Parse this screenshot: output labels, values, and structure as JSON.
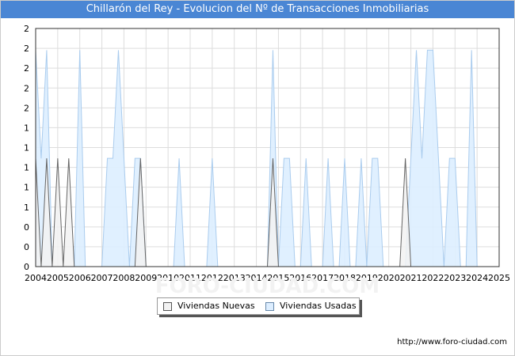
{
  "title": "Chillarón del Rey - Evolucion del Nº de Transacciones Inmobiliarias",
  "url": "http://www.foro-ciudad.com",
  "watermark": "FORO-CIUDAD.COM",
  "colors": {
    "title_bg": "#4a86d4",
    "nuevas_fill": "#f2f2f2",
    "nuevas_line": "#666666",
    "usadas_fill": "#ddeeff",
    "usadas_line": "#aaccee"
  },
  "chart_data": {
    "type": "area",
    "title": "Chillarón del Rey - Evolucion del Nº de Transacciones Inmobiliarias",
    "xlabel": "",
    "ylabel": "",
    "x_tick_labels": [
      "2004",
      "2005",
      "2006",
      "2007",
      "2008",
      "2009",
      "2010",
      "2011",
      "2012",
      "2013",
      "2014",
      "2015",
      "2016",
      "2017",
      "2018",
      "2019",
      "2020",
      "2021",
      "2022",
      "2023",
      "2024",
      "2025"
    ],
    "y_tick_labels": [
      "0",
      "0",
      "0",
      "1",
      "1",
      "1",
      "1",
      "1",
      "2",
      "2",
      "2",
      "2"
    ],
    "xlim": [
      2004,
      2025
    ],
    "ylim": [
      0,
      2.2
    ],
    "grid": true,
    "legend_position": "bottom-center",
    "series": [
      {
        "name": "Viviendas Nuevas",
        "points": [
          [
            2004,
            1
          ],
          [
            2004.25,
            0
          ],
          [
            2004.5,
            1
          ],
          [
            2004.75,
            0
          ],
          [
            2005,
            1
          ],
          [
            2005.25,
            0
          ],
          [
            2005.5,
            1
          ],
          [
            2005.75,
            0
          ],
          [
            2008.5,
            0
          ],
          [
            2008.75,
            1
          ],
          [
            2009,
            0
          ],
          [
            2014.5,
            0
          ],
          [
            2014.75,
            1
          ],
          [
            2015,
            0
          ],
          [
            2020.5,
            0
          ],
          [
            2020.75,
            1
          ],
          [
            2021,
            0
          ]
        ]
      },
      {
        "name": "Viviendas Usadas",
        "points": [
          [
            2004,
            2
          ],
          [
            2004.25,
            1
          ],
          [
            2004.5,
            2
          ],
          [
            2004.75,
            0
          ],
          [
            2005.75,
            0
          ],
          [
            2006,
            2
          ],
          [
            2006.25,
            0
          ],
          [
            2007,
            0
          ],
          [
            2007.25,
            1
          ],
          [
            2007.5,
            1
          ],
          [
            2007.75,
            2
          ],
          [
            2008,
            1
          ],
          [
            2008.25,
            0
          ],
          [
            2008.5,
            1
          ],
          [
            2008.75,
            1
          ],
          [
            2009,
            0
          ],
          [
            2010.25,
            0
          ],
          [
            2010.5,
            1
          ],
          [
            2010.75,
            0
          ],
          [
            2011.75,
            0
          ],
          [
            2012,
            1
          ],
          [
            2012.25,
            0
          ],
          [
            2014.5,
            0
          ],
          [
            2014.75,
            2
          ],
          [
            2015,
            0
          ],
          [
            2015.25,
            1
          ],
          [
            2015.5,
            1
          ],
          [
            2015.75,
            0
          ],
          [
            2016,
            0
          ],
          [
            2016.25,
            1
          ],
          [
            2016.5,
            0
          ],
          [
            2017,
            0
          ],
          [
            2017.25,
            1
          ],
          [
            2017.5,
            0
          ],
          [
            2017.75,
            0
          ],
          [
            2018,
            1
          ],
          [
            2018.25,
            0
          ],
          [
            2018.5,
            0
          ],
          [
            2018.75,
            1
          ],
          [
            2019,
            0
          ],
          [
            2019.25,
            1
          ],
          [
            2019.5,
            1
          ],
          [
            2019.75,
            0
          ],
          [
            2020.75,
            0
          ],
          [
            2021,
            1
          ],
          [
            2021.25,
            2
          ],
          [
            2021.5,
            1
          ],
          [
            2021.75,
            2
          ],
          [
            2022,
            2
          ],
          [
            2022.25,
            1
          ],
          [
            2022.5,
            0
          ],
          [
            2022.75,
            1
          ],
          [
            2023,
            1
          ],
          [
            2023.25,
            0
          ],
          [
            2023.5,
            0
          ],
          [
            2023.75,
            2
          ],
          [
            2024,
            0
          ]
        ]
      }
    ]
  }
}
